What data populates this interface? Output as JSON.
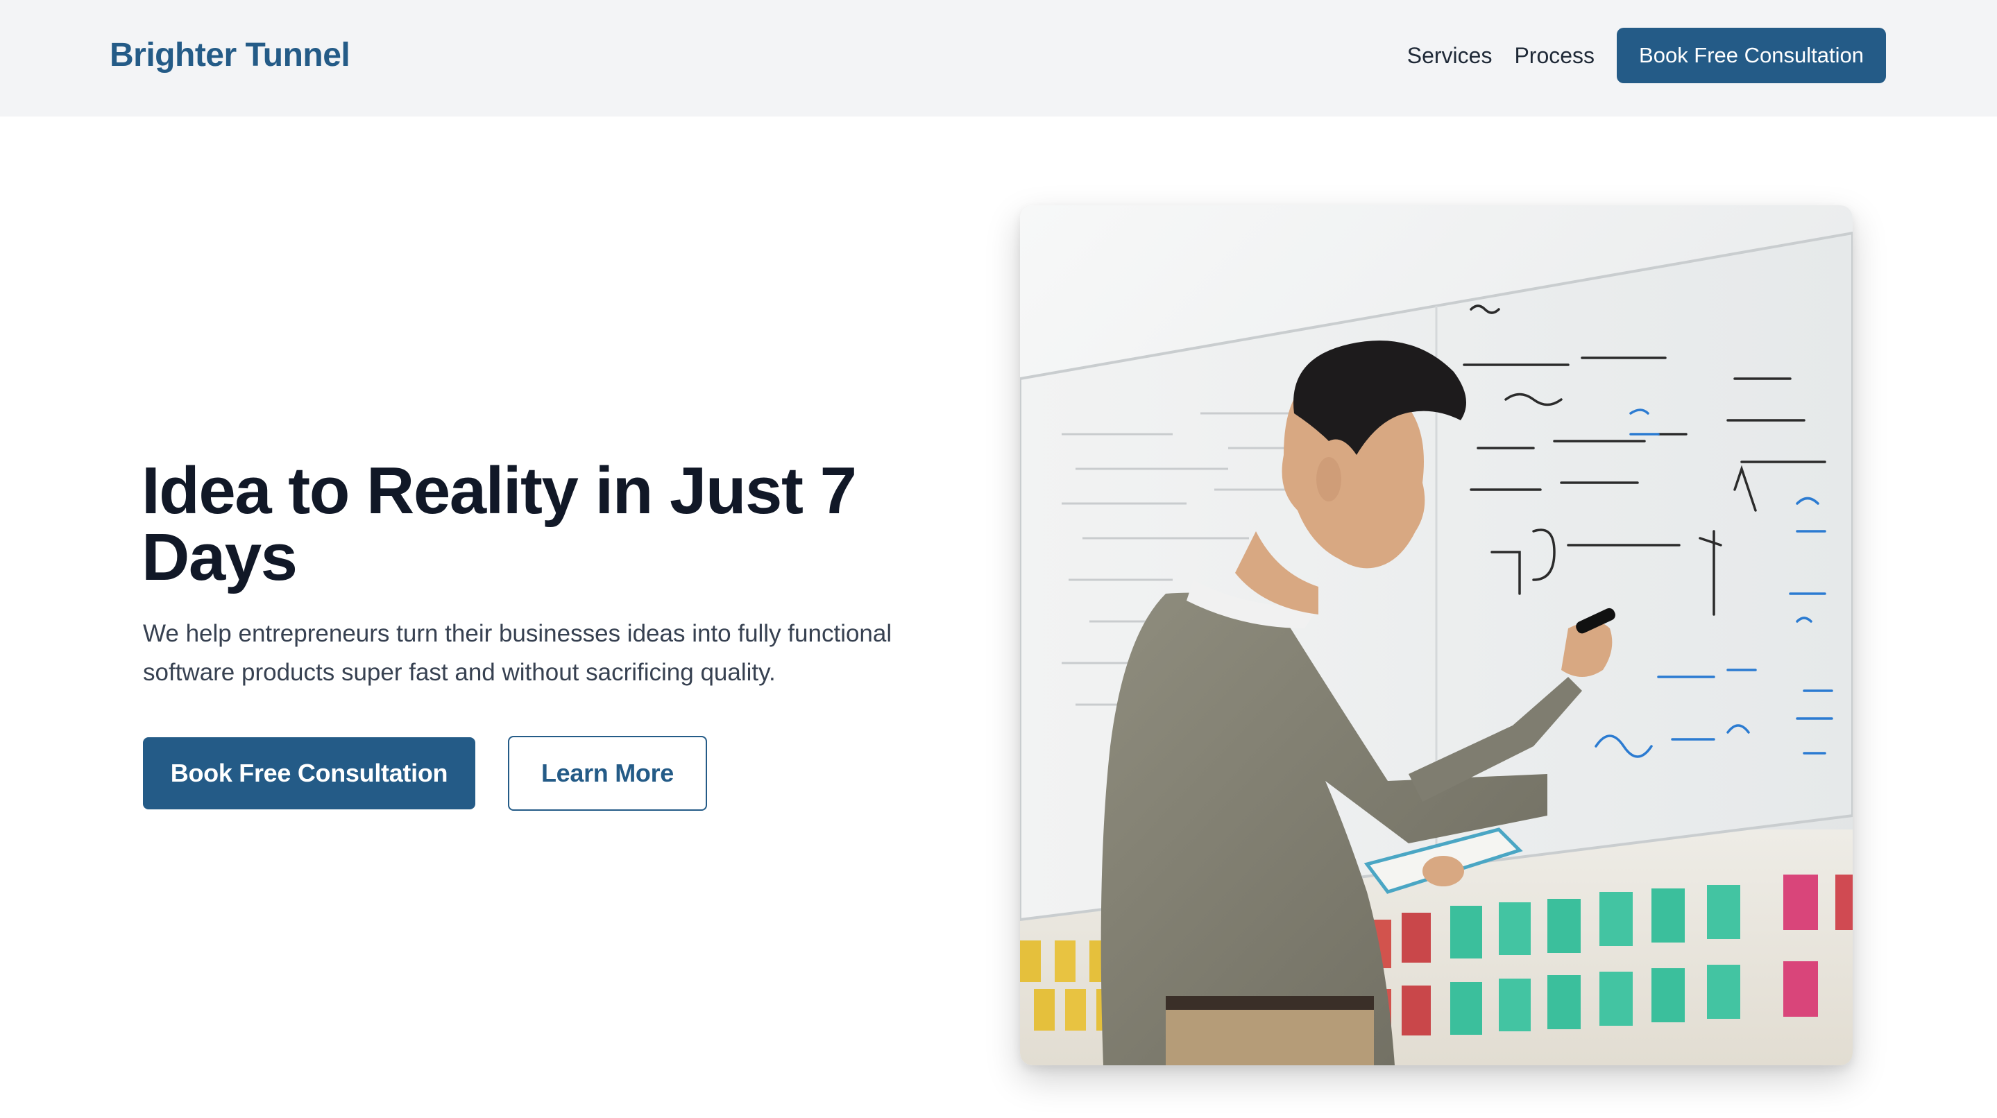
{
  "navbar": {
    "brand": "Brighter Tunnel",
    "links": [
      {
        "label": "Services"
      },
      {
        "label": "Process"
      }
    ],
    "cta_label": "Book Free Consultation"
  },
  "hero": {
    "title": "Idea to Reality in Just 7 Days",
    "subtitle": "We help entrepreneurs turn their businesses ideas into fully functional software products super fast and without sacrificing quality.",
    "primary_button": "Book Free Consultation",
    "secondary_button": "Learn More"
  },
  "colors": {
    "brand": "#245b87",
    "nav_background": "#f3f4f6",
    "heading": "#111827",
    "body_text": "#374151"
  }
}
